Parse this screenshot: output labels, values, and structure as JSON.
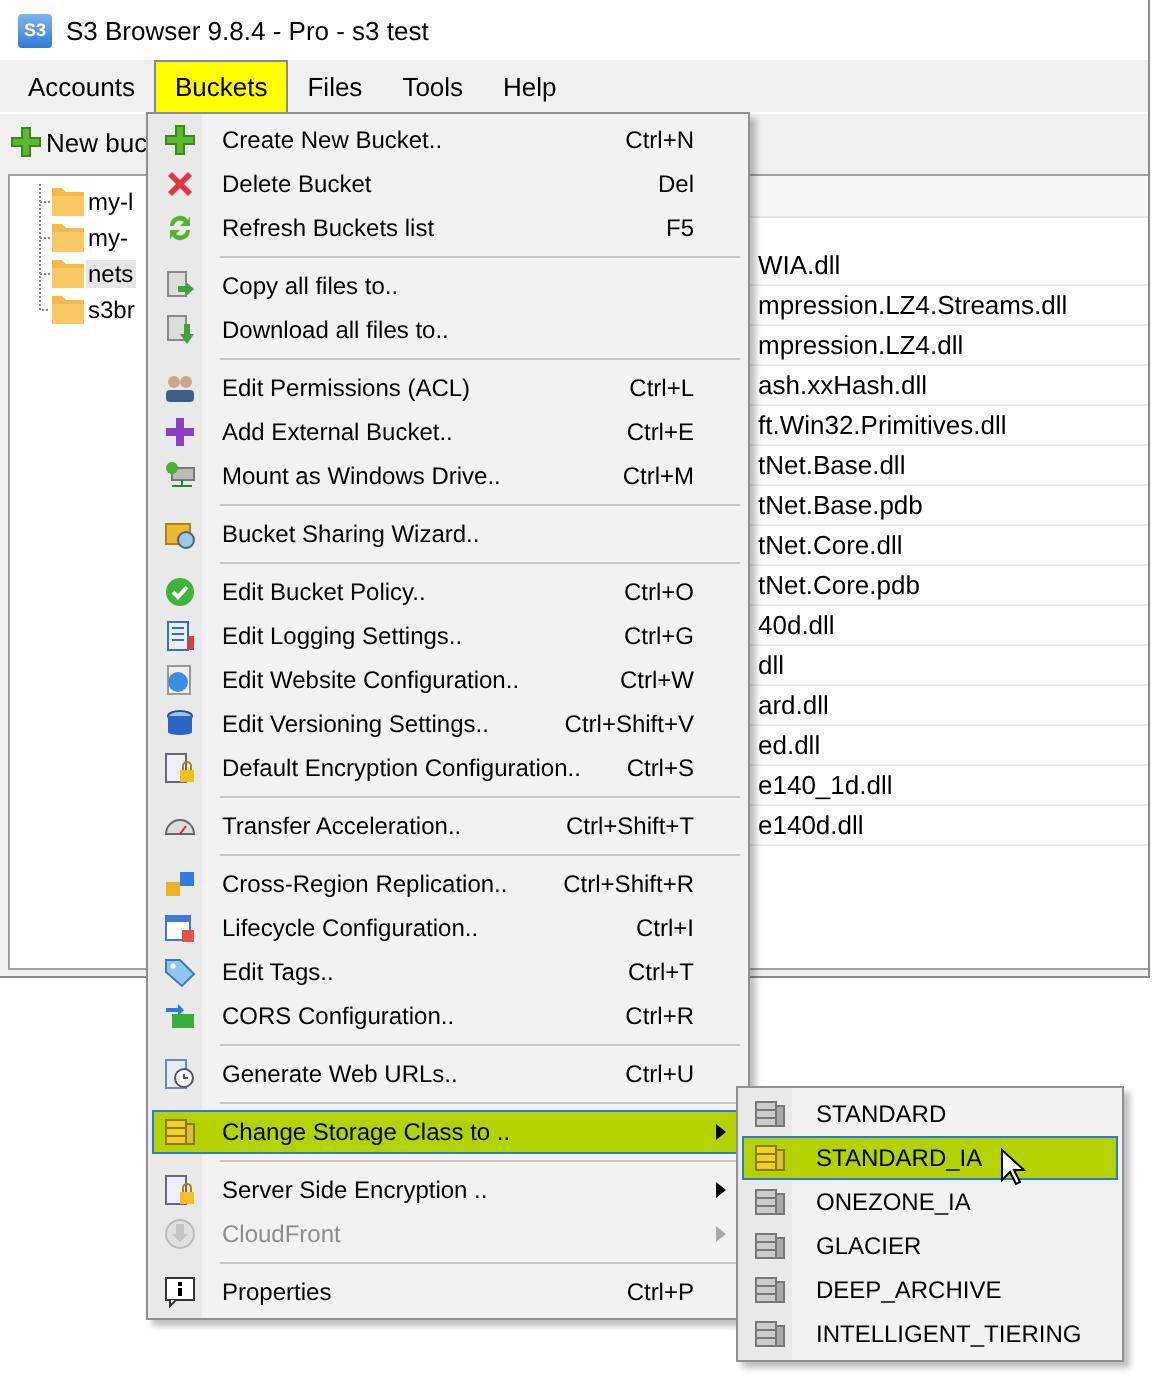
{
  "window": {
    "icon_label": "S3",
    "title": "S3 Browser 9.8.4 - Pro - s3 test"
  },
  "menubar": [
    {
      "label": "Accounts",
      "selected": false
    },
    {
      "label": "Buckets",
      "selected": true
    },
    {
      "label": "Files",
      "selected": false
    },
    {
      "label": "Tools",
      "selected": false
    },
    {
      "label": "Help",
      "selected": false
    }
  ],
  "toolbar": {
    "new_bucket": "New buc"
  },
  "tree": [
    {
      "label": "my-l",
      "selected": false
    },
    {
      "label": "my-",
      "selected": false
    },
    {
      "label": "nets",
      "selected": true
    },
    {
      "label": "s3br",
      "selected": false
    }
  ],
  "files": [
    "WIA.dll",
    "mpression.LZ4.Streams.dll",
    "mpression.LZ4.dll",
    "ash.xxHash.dll",
    "ft.Win32.Primitives.dll",
    "tNet.Base.dll",
    "tNet.Base.pdb",
    "tNet.Core.dll",
    "tNet.Core.pdb",
    "40d.dll",
    "dll",
    "ard.dll",
    "ed.dll",
    "e140_1d.dll",
    "e140d.dll"
  ],
  "menu": [
    {
      "kind": "item",
      "label": "Create New Bucket..",
      "shortcut": "Ctrl+N",
      "selected": false,
      "disabled": false,
      "submenu": false
    },
    {
      "kind": "item",
      "label": "Delete Bucket",
      "shortcut": "Del",
      "selected": false,
      "disabled": false,
      "submenu": false
    },
    {
      "kind": "item",
      "label": "Refresh Buckets list",
      "shortcut": "F5",
      "selected": false,
      "disabled": false,
      "submenu": false
    },
    {
      "kind": "separator"
    },
    {
      "kind": "item",
      "label": "Copy all files to..",
      "selected": false,
      "disabled": false,
      "submenu": false
    },
    {
      "kind": "item",
      "label": "Download all files to..",
      "selected": false,
      "disabled": false,
      "submenu": false
    },
    {
      "kind": "separator"
    },
    {
      "kind": "item",
      "label": "Edit Permissions (ACL)",
      "shortcut": "Ctrl+L",
      "selected": false,
      "disabled": false,
      "submenu": false
    },
    {
      "kind": "item",
      "label": "Add External Bucket..",
      "shortcut": "Ctrl+E",
      "selected": false,
      "disabled": false,
      "submenu": false
    },
    {
      "kind": "item",
      "label": "Mount as Windows Drive..",
      "shortcut": "Ctrl+M",
      "selected": false,
      "disabled": false,
      "submenu": false
    },
    {
      "kind": "separator"
    },
    {
      "kind": "item",
      "label": "Bucket Sharing Wizard..",
      "selected": false,
      "disabled": false,
      "submenu": false
    },
    {
      "kind": "separator"
    },
    {
      "kind": "item",
      "label": "Edit Bucket Policy..",
      "shortcut": "Ctrl+O",
      "selected": false,
      "disabled": false,
      "submenu": false
    },
    {
      "kind": "item",
      "label": "Edit Logging Settings..",
      "shortcut": "Ctrl+G",
      "selected": false,
      "disabled": false,
      "submenu": false
    },
    {
      "kind": "item",
      "label": "Edit Website Configuration..",
      "shortcut": "Ctrl+W",
      "selected": false,
      "disabled": false,
      "submenu": false
    },
    {
      "kind": "item",
      "label": "Edit Versioning Settings..",
      "shortcut": "Ctrl+Shift+V",
      "selected": false,
      "disabled": false,
      "submenu": false
    },
    {
      "kind": "item",
      "label": "Default Encryption Configuration..",
      "shortcut": "Ctrl+S",
      "selected": false,
      "disabled": false,
      "submenu": false
    },
    {
      "kind": "separator"
    },
    {
      "kind": "item",
      "label": "Transfer Acceleration..",
      "shortcut": "Ctrl+Shift+T",
      "selected": false,
      "disabled": false,
      "submenu": false
    },
    {
      "kind": "separator"
    },
    {
      "kind": "item",
      "label": "Cross-Region Replication..",
      "shortcut": "Ctrl+Shift+R",
      "selected": false,
      "disabled": false,
      "submenu": false
    },
    {
      "kind": "item",
      "label": "Lifecycle Configuration..",
      "shortcut": "Ctrl+I",
      "selected": false,
      "disabled": false,
      "submenu": false
    },
    {
      "kind": "item",
      "label": "Edit Tags..",
      "shortcut": "Ctrl+T",
      "selected": false,
      "disabled": false,
      "submenu": false
    },
    {
      "kind": "item",
      "label": "CORS Configuration..",
      "shortcut": "Ctrl+R",
      "selected": false,
      "disabled": false,
      "submenu": false
    },
    {
      "kind": "separator"
    },
    {
      "kind": "item",
      "label": "Generate Web URLs..",
      "shortcut": "Ctrl+U",
      "selected": false,
      "disabled": false,
      "submenu": false
    },
    {
      "kind": "separator"
    },
    {
      "kind": "item",
      "label": "Change Storage Class to ..",
      "selected": true,
      "disabled": false,
      "submenu": true
    },
    {
      "kind": "separator"
    },
    {
      "kind": "item",
      "label": "Server Side Encryption ..",
      "selected": false,
      "disabled": false,
      "submenu": true
    },
    {
      "kind": "item",
      "label": "CloudFront",
      "selected": false,
      "disabled": true,
      "submenu": true
    },
    {
      "kind": "separator"
    },
    {
      "kind": "item",
      "label": "Properties",
      "shortcut": "Ctrl+P",
      "selected": false,
      "disabled": false,
      "submenu": false
    }
  ],
  "submenu": [
    {
      "label": "STANDARD",
      "selected": false
    },
    {
      "label": "STANDARD_IA",
      "selected": true
    },
    {
      "label": "ONEZONE_IA",
      "selected": false
    },
    {
      "label": "GLACIER",
      "selected": false
    },
    {
      "label": "DEEP_ARCHIVE",
      "selected": false
    },
    {
      "label": "INTELLIGENT_TIERING",
      "selected": false
    }
  ]
}
